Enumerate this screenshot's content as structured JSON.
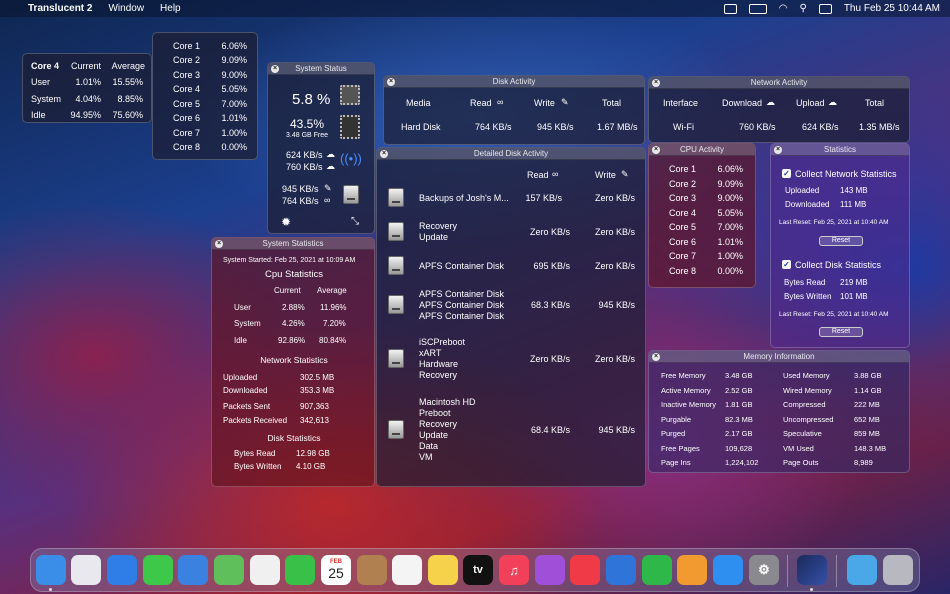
{
  "menubar": {
    "app": "Translucent 2",
    "menus": [
      "Window",
      "Help"
    ],
    "clock": "Thu Feb 25  10:44 AM"
  },
  "core4": {
    "title": "Core 4",
    "col_current": "Current",
    "col_average": "Average",
    "rows": [
      {
        "label": "User",
        "current": "1.01%",
        "average": "15.55%"
      },
      {
        "label": "System",
        "current": "4.04%",
        "average": "8.85%"
      },
      {
        "label": "Idle",
        "current": "94.95%",
        "average": "75.60%"
      }
    ]
  },
  "cores_popup": [
    {
      "label": "Core 1",
      "value": "6.06%"
    },
    {
      "label": "Core 2",
      "value": "9.09%"
    },
    {
      "label": "Core 3",
      "value": "9.00%"
    },
    {
      "label": "Core 4",
      "value": "5.05%"
    },
    {
      "label": "Core 5",
      "value": "7.00%"
    },
    {
      "label": "Core 6",
      "value": "1.01%"
    },
    {
      "label": "Core 7",
      "value": "1.00%"
    },
    {
      "label": "Core 8",
      "value": "0.00%"
    }
  ],
  "system_status": {
    "title": "System Status",
    "cpu": "5.8 %",
    "memory": "43.5%",
    "memory_free": "3.48 GB Free",
    "net_up": "624 KB/s",
    "net_down": "760 KB/s",
    "disk_write": "945 KB/s",
    "disk_read": "764 KB/s"
  },
  "disk_activity": {
    "title": "Disk Activity",
    "headers": {
      "media": "Media",
      "read": "Read",
      "write": "Write",
      "total": "Total"
    },
    "row": {
      "media": "Hard Disk",
      "read": "764 KB/s",
      "write": "945 KB/s",
      "total": "1.67 MB/s"
    }
  },
  "network_activity": {
    "title": "Network Activity",
    "headers": {
      "interface": "Interface",
      "download": "Download",
      "upload": "Upload",
      "total": "Total"
    },
    "row": {
      "interface": "Wi-Fi",
      "download": "760 KB/s",
      "upload": "624 KB/s",
      "total": "1.35 MB/s"
    }
  },
  "detailed_disk": {
    "title": "Detailed Disk Activity",
    "headers": {
      "read": "Read",
      "write": "Write"
    },
    "rows": [
      {
        "lines": [
          "Backups of Josh's M..."
        ],
        "read": "157 KB/s",
        "write": "Zero KB/s"
      },
      {
        "lines": [
          "Recovery",
          "Update"
        ],
        "read": "Zero KB/s",
        "write": "Zero KB/s"
      },
      {
        "lines": [
          "APFS Container Disk"
        ],
        "read": "695 KB/s",
        "write": "Zero KB/s"
      },
      {
        "lines": [
          "APFS Container Disk",
          "APFS Container Disk",
          "APFS Container Disk"
        ],
        "read": "68.3 KB/s",
        "write": "945 KB/s"
      },
      {
        "lines": [
          "iSCPreboot",
          "xART",
          "Hardware",
          "Recovery"
        ],
        "read": "Zero KB/s",
        "write": "Zero KB/s"
      },
      {
        "lines": [
          "Macintosh HD",
          "Preboot",
          "Recovery",
          "Update",
          "Data",
          "VM"
        ],
        "read": "68.4 KB/s",
        "write": "945 KB/s"
      }
    ]
  },
  "cpu_activity": {
    "title": "CPU Activity",
    "cores": [
      {
        "label": "Core 1",
        "value": "6.06%"
      },
      {
        "label": "Core 2",
        "value": "9.09%"
      },
      {
        "label": "Core 3",
        "value": "9.00%"
      },
      {
        "label": "Core 4",
        "value": "5.05%"
      },
      {
        "label": "Core 5",
        "value": "7.00%"
      },
      {
        "label": "Core 6",
        "value": "1.01%"
      },
      {
        "label": "Core 7",
        "value": "1.00%"
      },
      {
        "label": "Core 8",
        "value": "0.00%"
      }
    ]
  },
  "statistics": {
    "title": "Statistics",
    "net_label": "Collect Network Statistics",
    "uploaded_label": "Uploaded",
    "uploaded": "143 MB",
    "downloaded_label": "Downloaded",
    "downloaded": "111 MB",
    "last_reset": "Last Reset:  Feb 25, 2021 at 10:40 AM",
    "reset": "Reset",
    "disk_label": "Collect Disk Statistics",
    "bytes_read_label": "Bytes Read",
    "bytes_read": "219 MB",
    "bytes_written_label": "Bytes Written",
    "bytes_written": "101 MB",
    "last_reset2": "Last Reset:  Feb 25, 2021 at 10:40 AM",
    "reset2": "Reset"
  },
  "system_statistics": {
    "title": "System Statistics",
    "started": "System Started:  Feb 25, 2021 at 10:09 AM",
    "cpu_heading": "Cpu Statistics",
    "col_current": "Current",
    "col_average": "Average",
    "cpu_rows": [
      {
        "label": "User",
        "current": "2.88%",
        "average": "11.96%"
      },
      {
        "label": "System",
        "current": "4.26%",
        "average": "7.20%"
      },
      {
        "label": "Idle",
        "current": "92.86%",
        "average": "80.84%"
      }
    ],
    "net_heading": "Network Statistics",
    "net_rows": [
      {
        "label": "Uploaded",
        "value": "302.5 MB"
      },
      {
        "label": "Downloaded",
        "value": "353.3 MB"
      },
      {
        "label": "Packets Sent",
        "value": "907,363"
      },
      {
        "label": "Packets Received",
        "value": "342,613"
      }
    ],
    "disk_heading": "Disk Statistics",
    "disk_rows": [
      {
        "label": "Bytes Read",
        "value": "12.98 GB"
      },
      {
        "label": "Bytes Written",
        "value": "4.10 GB"
      }
    ]
  },
  "memory": {
    "title": "Memory Information",
    "left": [
      {
        "label": "Free Memory",
        "value": "3.48 GB"
      },
      {
        "label": "Active Memory",
        "value": "2.52 GB"
      },
      {
        "label": "Inactive Memory",
        "value": "1.81 GB"
      },
      {
        "label": "Purgable",
        "value": "82.3 MB"
      },
      {
        "label": "Purged",
        "value": "2.17 GB"
      },
      {
        "label": "Free Pages",
        "value": "109,628"
      },
      {
        "label": "Page Ins",
        "value": "1,224,102"
      }
    ],
    "right": [
      {
        "label": "Used Memory",
        "value": "3.88 GB"
      },
      {
        "label": "Wired Memory",
        "value": "1.14 GB"
      },
      {
        "label": "Compressed",
        "value": "222 MB"
      },
      {
        "label": "Uncompressed",
        "value": "652 MB"
      },
      {
        "label": "Speculative",
        "value": "859 MB"
      },
      {
        "label": "VM Used",
        "value": "148.3 MB"
      },
      {
        "label": "Page Outs",
        "value": "8,989"
      }
    ]
  },
  "dock": {
    "calendar_month": "FEB",
    "calendar_day": "25",
    "tv_label": "tv",
    "colors": {
      "finder": "#3a8ee8",
      "launchpad": "#e8e8ee",
      "safari": "#2f7ee8",
      "messages": "#3ec84a",
      "mail": "#3b82e0",
      "maps": "#5fbf5a",
      "photos": "#f0f0f0",
      "facetime": "#38c048",
      "contacts": "#b08050",
      "reminders": "#f4f4f4",
      "notes": "#f5d24a",
      "tv": "#111111",
      "music": "#f2405a",
      "podcasts": "#a050d8",
      "news": "#f03a48",
      "keynote": "#2f74d8",
      "numbers": "#2fb84a",
      "pages": "#f09a30",
      "appstore": "#2e8ff0",
      "prefs": "#8a8a8e",
      "translucent": "#3550a8",
      "downloads": "#4aa8e8",
      "trash": "#b8b8c0"
    }
  }
}
